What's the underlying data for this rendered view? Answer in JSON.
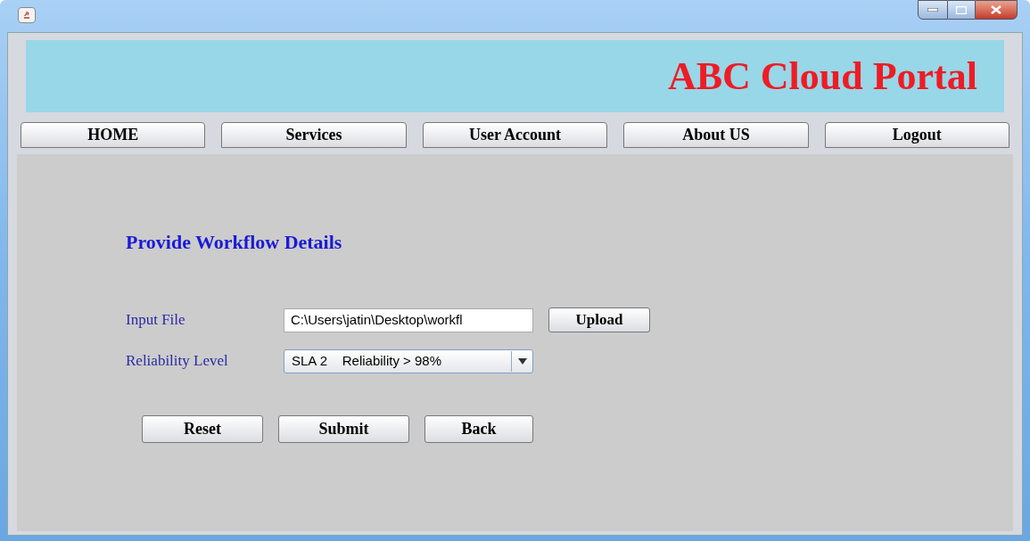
{
  "banner": {
    "title": "ABC Cloud Portal"
  },
  "nav": [
    {
      "label": "HOME"
    },
    {
      "label": "Services"
    },
    {
      "label": "User Account"
    },
    {
      "label": "About US"
    },
    {
      "label": "Logout"
    }
  ],
  "form": {
    "heading": "Provide Workflow Details",
    "input_file": {
      "label": "Input File",
      "value": "C:\\Users\\jatin\\Desktop\\workfl",
      "button": "Upload"
    },
    "reliability": {
      "label": "Reliability Level",
      "value": "SLA 2    Reliability > 98%"
    },
    "buttons": [
      "Reset",
      "Submit",
      "Back"
    ]
  }
}
